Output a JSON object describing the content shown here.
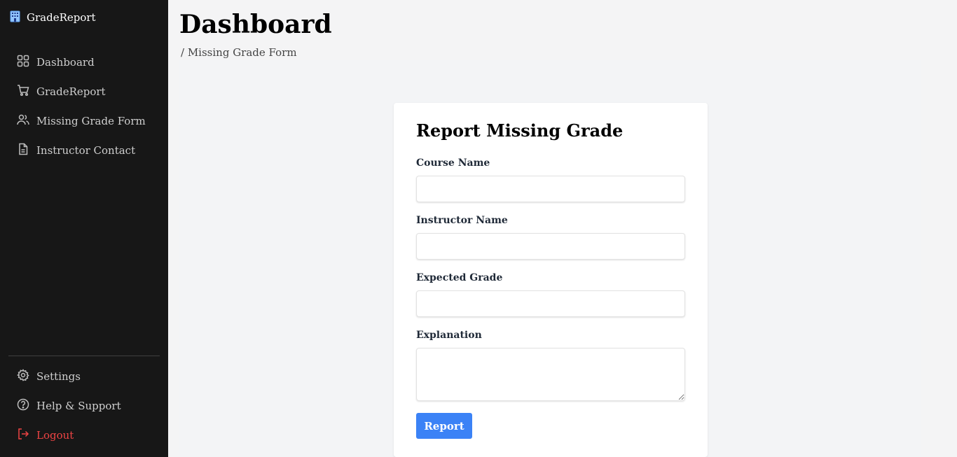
{
  "app": {
    "name": "GradeReport",
    "logo_icon": "building-icon"
  },
  "sidebar": {
    "items": [
      {
        "label": "Dashboard",
        "icon": "grid-icon"
      },
      {
        "label": "GradeReport",
        "icon": "cart-icon"
      },
      {
        "label": "Missing Grade Form",
        "icon": "users-icon"
      },
      {
        "label": "Instructor Contact",
        "icon": "document-icon"
      }
    ],
    "bottom": [
      {
        "label": "Settings",
        "icon": "gear-icon"
      },
      {
        "label": "Help & Support",
        "icon": "help-circle-icon"
      },
      {
        "label": "Logout",
        "icon": "logout-icon",
        "color": "#ef4444"
      }
    ]
  },
  "header": {
    "title": "Dashboard",
    "breadcrumb": "/ Missing Grade Form"
  },
  "form": {
    "title": "Report Missing Grade",
    "fields": [
      {
        "label": "Course Name",
        "value": "",
        "placeholder": ""
      },
      {
        "label": "Instructor Name",
        "value": "",
        "placeholder": ""
      },
      {
        "label": "Expected Grade",
        "value": "",
        "placeholder": ""
      },
      {
        "label": "Explanation",
        "value": "",
        "placeholder": ""
      }
    ],
    "submit_label": "Report"
  },
  "colors": {
    "sidebar_bg": "#171717",
    "accent": "#3b82f6",
    "danger": "#ef4444"
  }
}
